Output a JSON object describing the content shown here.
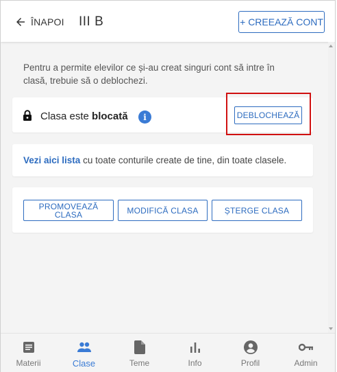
{
  "header": {
    "back_label": "ÎNAPOI",
    "class_title": "III B",
    "create_account_label": "+ CREEAZĂ CONT"
  },
  "intro_text": "Pentru a permite elevilor ce și-au creat singuri cont să intre în clasă, trebuie să o deblochezi.",
  "lock_card": {
    "status_prefix": "Clasa este",
    "status_value": "blocată",
    "info_icon_glyph": "i",
    "unlock_label": "DEBLOCHEAZĂ"
  },
  "list_card": {
    "link_text": "Vezi aici lista",
    "rest_text": " cu toate conturile create de tine, din toate clasele."
  },
  "actions": {
    "promote_label": "PROMOVEAZĂ CLASA",
    "modify_label": "MODIFICĂ CLASA",
    "delete_label": "ȘTERGE CLASA"
  },
  "bottom_nav": {
    "items": [
      {
        "label": "Materii",
        "icon": "book-icon"
      },
      {
        "label": "Clase",
        "icon": "people-icon",
        "active": true
      },
      {
        "label": "Teme",
        "icon": "document-icon"
      },
      {
        "label": "Info",
        "icon": "bar-chart-icon"
      },
      {
        "label": "Profil",
        "icon": "account-circle-icon"
      },
      {
        "label": "Admin",
        "icon": "key-icon"
      }
    ]
  },
  "colors": {
    "accent": "#2c6bbf",
    "info_icon": "#3a7bd5",
    "highlight": "#d01010",
    "nav_inactive": "#777777",
    "background": "#f4f4f4"
  }
}
